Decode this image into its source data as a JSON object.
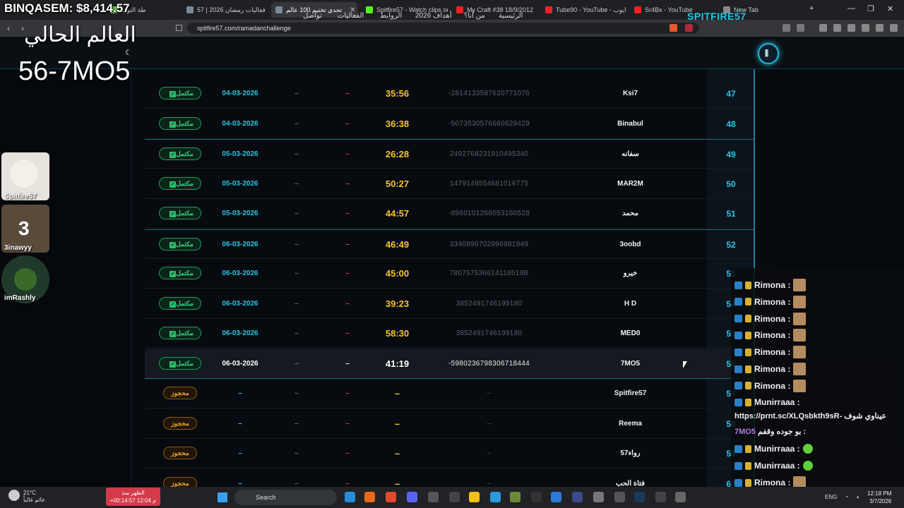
{
  "tabs": [
    {
      "label": "طة التوب",
      "color": "#7c5"
    },
    {
      "label": "57 | فعاليات رمضان 2026",
      "color": "#7a8a9a"
    },
    {
      "label": "تحدي تختيم 100 عالم",
      "color": "#7a8a9a"
    },
    {
      "label": "Spitfire57 - Watch clips on",
      "color": "#53fc18"
    },
    {
      "label": "My Craft #38 18/9/2012",
      "color": "#e22"
    },
    {
      "label": "Tube90 - YouTube - ايوب",
      "color": "#e22"
    },
    {
      "label": "Sr4Bx - YouTube",
      "color": "#e22"
    },
    {
      "label": "New Tab",
      "color": "#888"
    }
  ],
  "browser": {
    "url": "spitfire57.com/ramadanchallenge"
  },
  "site": {
    "logo": "SPITFIRE57",
    "logo_mark": "⫼",
    "nav": [
      "الرئيسية",
      "من أنا؟",
      "أهداف 2026",
      "الروابط",
      "الفعاليات",
      "تواصل"
    ]
  },
  "overlay": {
    "networth": "BINQASEM: $8,414.57",
    "world_label": "العالم الحالي",
    "current": "56-7MO5",
    "avatars": [
      {
        "label": "Spitfire57"
      },
      {
        "label": "3inawyy",
        "badge": "3"
      },
      {
        "label": "imRashly"
      }
    ]
  },
  "rows": [
    {
      "rank": "47",
      "name": "Ksi7",
      "id": "-2814133587620771076",
      "time": "35:56",
      "date": "04-03-2026",
      "status": "مكتمل"
    },
    {
      "rank": "48",
      "name": "Binabul",
      "id": "-5073530576660629429",
      "time": "36:38",
      "date": "04-03-2026",
      "status": "مكتمل"
    },
    {
      "rank": "49",
      "name": "سفانه",
      "id": "2492768231910495340",
      "time": "26:28",
      "date": "05-03-2026",
      "status": "مكتمل"
    },
    {
      "rank": "50",
      "name": "MAR2M",
      "id": "1479149554681016775",
      "time": "50:27",
      "date": "05-03-2026",
      "status": "مكتمل"
    },
    {
      "rank": "51",
      "name": "محمد",
      "id": "-8960101266053160528",
      "time": "44:57",
      "date": "05-03-2026",
      "status": "مكتمل"
    },
    {
      "rank": "52",
      "name": "3oobd",
      "id": "3340896702996981949",
      "time": "46:49",
      "date": "06-03-2026",
      "status": "مكتمل"
    },
    {
      "rank": "53",
      "name": "خيرو",
      "id": "780757536614116519B",
      "time": "45:00",
      "date": "06-03-2026",
      "status": "مكتمل"
    },
    {
      "rank": "54",
      "name": "H D",
      "id": "3852491746199180",
      "time": "39:23",
      "date": "06-03-2026",
      "status": "مكتمل"
    },
    {
      "rank": "55",
      "name": "MED0",
      "id": "3852491746199180",
      "time": "58:30",
      "date": "06-03-2026",
      "status": "مكتمل"
    },
    {
      "rank": "56",
      "name": "7MO5",
      "id": "-5980236798306718444",
      "time": "41:19",
      "date": "06-03-2026",
      "status": "مكتمل"
    },
    {
      "rank": "57",
      "name": "Spitfire57",
      "id": "–",
      "time": "–",
      "date": "–",
      "status": "محجوز"
    },
    {
      "rank": "58",
      "name": "Reema",
      "id": "–",
      "time": "–",
      "date": "–",
      "status": "محجوز"
    },
    {
      "rank": "59",
      "name": "رواء57",
      "id": "–",
      "time": "–",
      "date": "–",
      "status": "محجوز"
    },
    {
      "rank": "60",
      "name": "فتاة الحب",
      "id": "–",
      "time": "–",
      "date": "–",
      "status": "محجوز"
    }
  ],
  "dash": "–",
  "chat": {
    "lines": [
      {
        "user": "Rimona :",
        "emote": "brown"
      },
      {
        "user": "Rimona :",
        "emote": "brown"
      },
      {
        "user": "Rimona :",
        "emote": "brown"
      },
      {
        "user": "Rimona :",
        "emote": "brown"
      },
      {
        "user": "Rimona :",
        "emote": "brown"
      },
      {
        "user": "Rimona :",
        "emote": "brown"
      },
      {
        "user": "Rimona :",
        "emote": "brown"
      },
      {
        "user": "Rimona :",
        "emote": "brown"
      }
    ],
    "muni_user": "Munirraaa :",
    "muni_msg1": "https://prnt.sc/XLQsbkth9sR- عيناوي شوف",
    "muni_msg2_a": "7MO5",
    "muni_msg2_b": "بو جوده وقفم :",
    "muni_emote_user1": "Munirraaa :",
    "muni_emote_user2": "Munirraaa :",
    "rimona_last1": "Rimona :",
    "rimona_last2": "Rimona :"
  },
  "taskbar": {
    "temp": "21°C",
    "weather": "غائم غالباً",
    "prayer_name": "الظهر",
    "prayer_time": "12:04 م",
    "prayer_since": "منذ",
    "prayer_count": "+00:14:57",
    "search": "Search",
    "lang": "ENG",
    "time": "12:18 PM",
    "date": "3/7/2026"
  }
}
